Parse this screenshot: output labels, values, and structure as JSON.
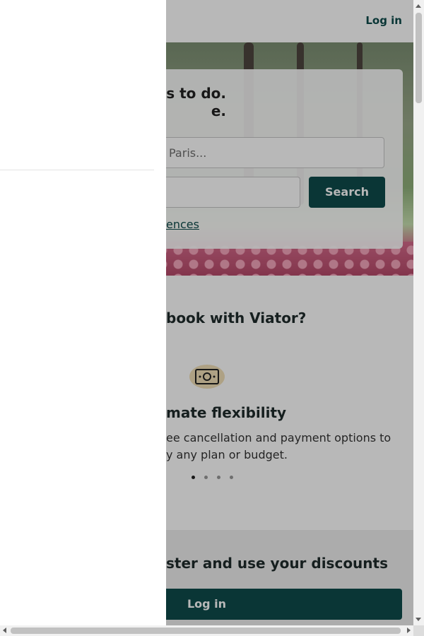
{
  "header": {
    "login_label": "Log in"
  },
  "hero": {
    "headline": "gs to do.\ne.",
    "where_placeholder": "Paris...",
    "search_label": "Search",
    "experiences_link": "ences"
  },
  "why": {
    "title": "book with Viator?",
    "icon": "money-icon",
    "feature_title": "mate flexibility",
    "feature_desc": "ee cancellation and payment options to\ny any plan or budget.",
    "carousel_total": 4,
    "carousel_active": 1
  },
  "promo": {
    "title": "ster and use your discounts",
    "login_button": "Log in"
  },
  "colors": {
    "brand": "#0f4c4c",
    "overlay": "rgba(0,0,0,0.28)"
  }
}
